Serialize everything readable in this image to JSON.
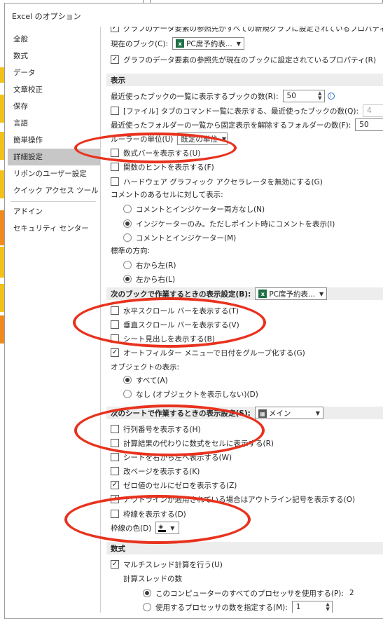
{
  "dialog": {
    "title": "Excel のオプション"
  },
  "sidebar": {
    "items": [
      {
        "label": "全般"
      },
      {
        "label": "数式"
      },
      {
        "label": "データ"
      },
      {
        "label": "文章校正"
      },
      {
        "label": "保存"
      },
      {
        "label": "言語"
      },
      {
        "label": "簡単操作"
      },
      {
        "label": "詳細設定",
        "active": true
      },
      {
        "label": "リボンのユーザー設定"
      },
      {
        "label": "クイック アクセス ツール バー"
      },
      {
        "label": "アドイン"
      },
      {
        "label": "セキュリティ センター"
      }
    ]
  },
  "chart_section": {
    "partial_top": "グラフのデータ要素の参照先がすべての新規グラフに設定されているプロパティ(E)",
    "current_book_label": "現在のブック(C):",
    "current_book_value": "PC席予約表...",
    "current_book_prop": "グラフのデータ要素の参照先が現在のブックに設定されているプロパティ(R)"
  },
  "display": {
    "header": "表示",
    "recent_books_label": "最近使ったブックの一覧に表示するブックの数(R):",
    "recent_books_value": "50",
    "quick_access_label": "[ファイル] タブのコマンド一覧に表示する、最近使ったブックの数(Q):",
    "quick_access_value": "4",
    "recent_folders_label": "最近使ったフォルダーの一覧から固定表示を解除するフォルダーの数(F):",
    "recent_folders_value": "50",
    "ruler_label": "ルーラーの単位(U)",
    "ruler_value": "既定の単位",
    "formula_bar": "数式バーを表示する(U)",
    "function_tips": "関数のヒントを表示する(F)",
    "hw_accel": "ハードウェア グラフィック アクセラレータを無効にする(G)",
    "comments_label": "コメントのあるセルに対して表示:",
    "comment_opt1": "コメントとインジケーター両方なし(N)",
    "comment_opt2": "インジケーターのみ。ただしポイント時にコメントを表示(I)",
    "comment_opt3": "コメントとインジケーター(M)",
    "direction_label": "標準の方向:",
    "dir_rtl": "右から左(R)",
    "dir_ltr": "左から右(L)"
  },
  "book_display": {
    "header": "次のブックで作業するときの表示設定(B):",
    "book_value": "PC席予約表...",
    "h_scroll": "水平スクロール バーを表示する(T)",
    "v_scroll": "垂直スクロール バーを表示する(V)",
    "sheet_tabs": "シート見出しを表示する(B)",
    "autofilter": "オートフィルター メニューで日付をグループ化する(G)",
    "objects_label": "オブジェクトの表示:",
    "obj_all": "すべて(A)",
    "obj_none": "なし (オブジェクトを表示しない)(D)"
  },
  "sheet_display": {
    "header": "次のシートで作業するときの表示設定(S):",
    "sheet_value": "メイン",
    "row_col_headers": "行列番号を表示する(H)",
    "formulas": "計算結果の代わりに数式をセルに表示する(R)",
    "rtl_sheet": "シートを右から左へ表示する(W)",
    "page_breaks": "改ページを表示する(K)",
    "zero_values": "ゼロ値のセルにゼロを表示する(Z)",
    "outline": "アウトラインが適用されている場合はアウトライン記号を表示する(O)",
    "gridlines": "枠線を表示する(D)",
    "grid_color_label": "枠線の色(D)"
  },
  "formulas_section": {
    "header": "数式",
    "multithread": "マルチスレッド計算を行う(U)",
    "threads_label": "計算スレッドの数",
    "all_processors": "このコンピューターのすべてのプロセッサを使用する(P):",
    "all_processors_count": "2",
    "manual": "使用するプロセッサの数を指定する(M):",
    "manual_value": "1"
  },
  "colors": {
    "accent_red": "#e8321e",
    "active_nav": "#c7c7c7",
    "section_bg": "#ededed"
  }
}
